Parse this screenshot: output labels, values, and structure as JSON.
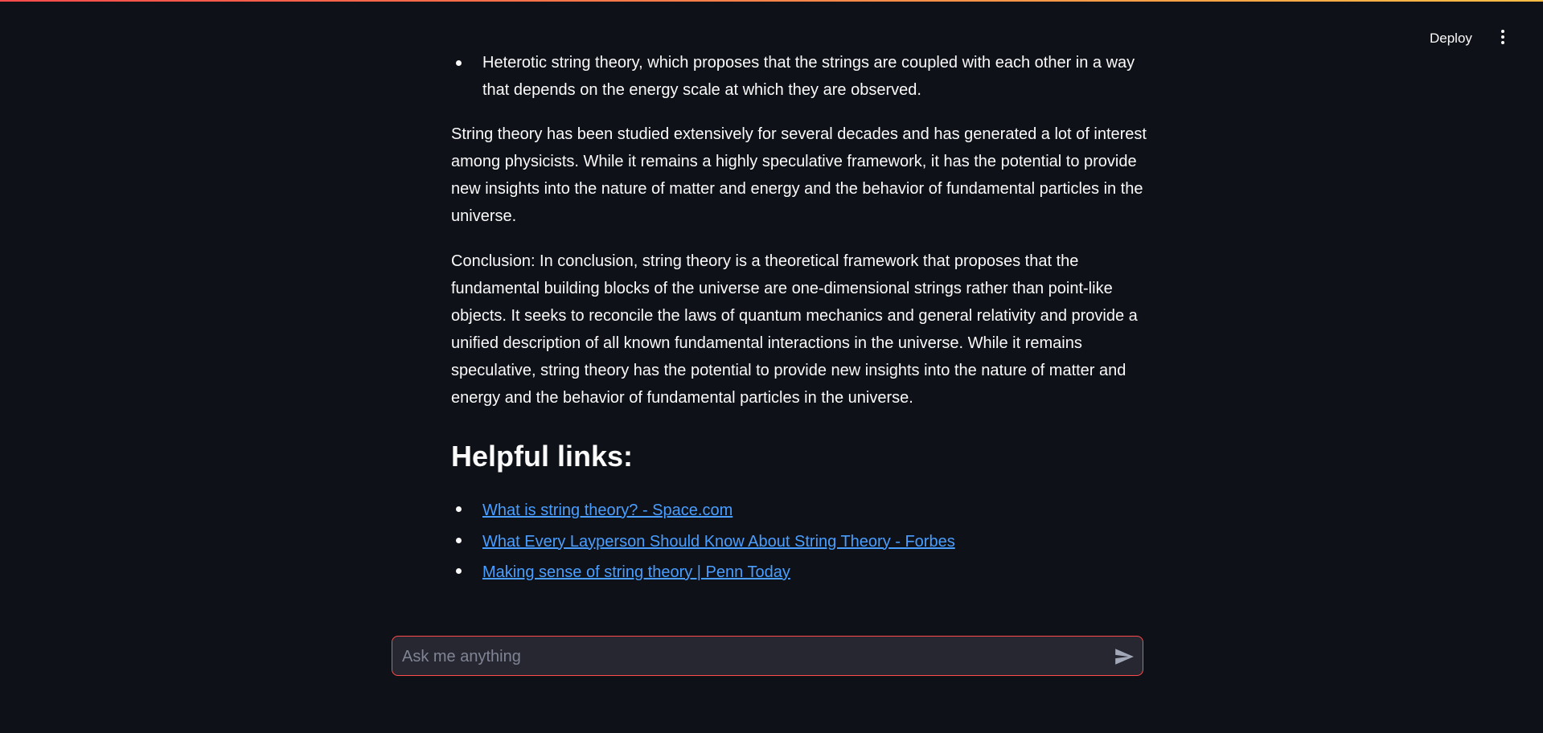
{
  "header": {
    "deploy_label": "Deploy",
    "menu_icon": "more-vertical-icon"
  },
  "content": {
    "partial_item_line1": "Heterotic string theory, which proposes that the strings are coupled with each other in a way",
    "partial_item_line2": "that depends on the energy scale at which they are observed.",
    "paragraph1": "String theory has been studied extensively for several decades and has generated a lot of interest among physicists. While it remains a highly speculative framework, it has the potential to provide new insights into the nature of matter and energy and the behavior of fundamental particles in the universe.",
    "paragraph2": "Conclusion: In conclusion, string theory is a theoretical framework that proposes that the fundamental building blocks of the universe are one-dimensional strings rather than point-like objects. It seeks to reconcile the laws of quantum mechanics and general relativity and provide a unified description of all known fundamental interactions in the universe. While it remains speculative, string theory has the potential to provide new insights into the nature of matter and energy and the behavior of fundamental particles in the universe.",
    "links_heading": "Helpful links:",
    "links": [
      {
        "label": "What is string theory? - Space.com"
      },
      {
        "label": "What Every Layperson Should Know About String Theory - Forbes"
      },
      {
        "label": "Making sense of string theory | Penn Today"
      }
    ]
  },
  "chat": {
    "placeholder": "Ask me anything",
    "send_icon": "send-icon"
  },
  "colors": {
    "background": "#0e1117",
    "accent": "#ff4b4b",
    "link": "#4a9eff",
    "input_bg": "#262730"
  }
}
